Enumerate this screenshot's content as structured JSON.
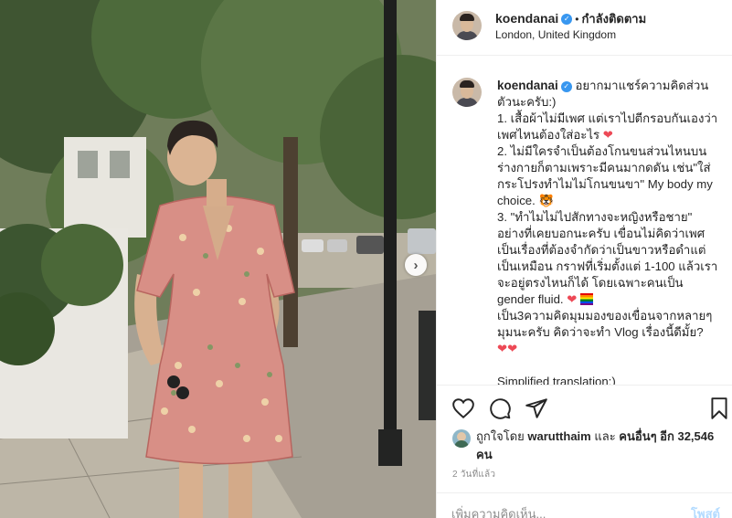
{
  "header": {
    "username": "koendanai",
    "separator": "•",
    "follow_status": "กำลังติดตาม",
    "location": "London, United Kingdom"
  },
  "caption": {
    "username": "koendanai",
    "lines": [
      "อยากมาแชร์ความคิดส่วนตัวนะครับ:)",
      "1. เสื้อผ้าไม่มีเพศ แต่เราไปตีกรอบกันเองว่าเพศไหนต้องใส่อะไร",
      "2. ไม่มีใครจำเป็นต้องโกนขนส่วนไหนบนร่างกายก็ตามเพราะมีคนมากดดัน เช่น\"ใส่กระโปรงทำไมไม่โกนขนขา\" My body my choice.",
      "3. \"ทำไมไม่ไปสักทางจะหญิงหรือชาย\" อย่างที่เคยบอกนะครับ เขื่อนไม่คิดว่าเพศเป็นเรื่องที่ต้องจำกัดว่าเป็นขาวหรือดำแต่เป็นเหมือน กราฟที่เริ่มตั้งแต่ 1-100 แล้วเราจะอยู่ตรงไหนก็ได้ โดยเฉพาะคนเป็น gender fluid.",
      "เป็น3ความคิดมุมมองของเขื่อนจากหลายๆมุมนะครับ คิดว่าจะทำ Vlog เรื่องนี้ดีมั้ย?",
      "Simplified translation:)"
    ]
  },
  "actions": {
    "like_icon": "heart-outline-icon",
    "comment_icon": "comment-bubble-icon",
    "share_icon": "paper-plane-icon",
    "save_icon": "bookmark-icon"
  },
  "likes": {
    "prefix": "ถูกใจโดย",
    "liker": "warutthaim",
    "conjunction": "และ",
    "others": "คนอื่นๆ อีก 32,546 คน"
  },
  "timestamp": "2 วันที่แล้ว",
  "comment": {
    "placeholder": "เพิ่มความคิดเห็น...",
    "post_label": "โพสต์"
  },
  "carousel": {
    "next_label": "›"
  },
  "colors": {
    "accent": "#3897f0",
    "heart": "#ed4956",
    "muted": "#8e8e8e",
    "post_disabled": "#b3dbff"
  }
}
